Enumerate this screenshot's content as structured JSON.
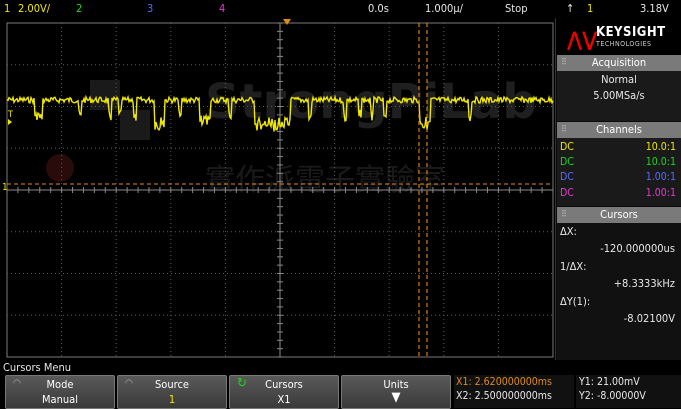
{
  "topbar": {
    "ch1_num": "1",
    "ch1_scale": "2.00V/",
    "ch2_num": "2",
    "ch3_num": "3",
    "ch4_num": "4",
    "time_delay": "0.0s",
    "time_scale": "1.000µ/",
    "run_state": "Stop",
    "trig_slope_icon": "↑",
    "trig_source": "1",
    "trig_level": "3.18V"
  },
  "brand": {
    "name": "KEYSIGHT",
    "sub": "TECHNOLOGIES"
  },
  "acquisition": {
    "header": "Acquisition",
    "mode": "Normal",
    "rate": "5.00MSa/s"
  },
  "channels": {
    "header": "Channels",
    "rows": [
      {
        "coupling": "DC",
        "ratio": "10.0:1",
        "color": "#f0e800"
      },
      {
        "coupling": "DC",
        "ratio": "10.0:1",
        "color": "#19d919"
      },
      {
        "coupling": "DC",
        "ratio": "1.00:1",
        "color": "#5a6bff"
      },
      {
        "coupling": "DC",
        "ratio": "1.00:1",
        "color": "#e23bd3"
      }
    ]
  },
  "cursors_panel": {
    "header": "Cursors",
    "dx_label": "ΔX:",
    "dx_value": "-120.000000us",
    "inv_dx_label": "1/ΔX:",
    "inv_dx_value": "+8.3333kHz",
    "dy_label": "ΔY(1):",
    "dy_value": "-8.02100V"
  },
  "menu": {
    "title": "Cursors Menu",
    "softkeys": [
      {
        "label": "Mode",
        "value": "Manual"
      },
      {
        "label": "Source",
        "value": "1"
      },
      {
        "label": "Cursors",
        "value": "X1"
      },
      {
        "label": "Units",
        "value": ""
      }
    ],
    "x1": "X1: 2.620000000ms",
    "x2": "X2: 2.500000000ms",
    "y1": "Y1: 21.00mV",
    "y2": "Y2: -8.00000V"
  },
  "markers": {
    "trig_level_marker": "T",
    "ch1_ground_marker": "1"
  },
  "colors": {
    "ch1": "#f0e800",
    "cursor": "#e08a1c",
    "grid": "#5a5a5a",
    "sidebar_header": "#7a7a7a"
  },
  "watermark": {
    "text": "StrongPiLab",
    "sub": "實作派電子實驗室"
  }
}
